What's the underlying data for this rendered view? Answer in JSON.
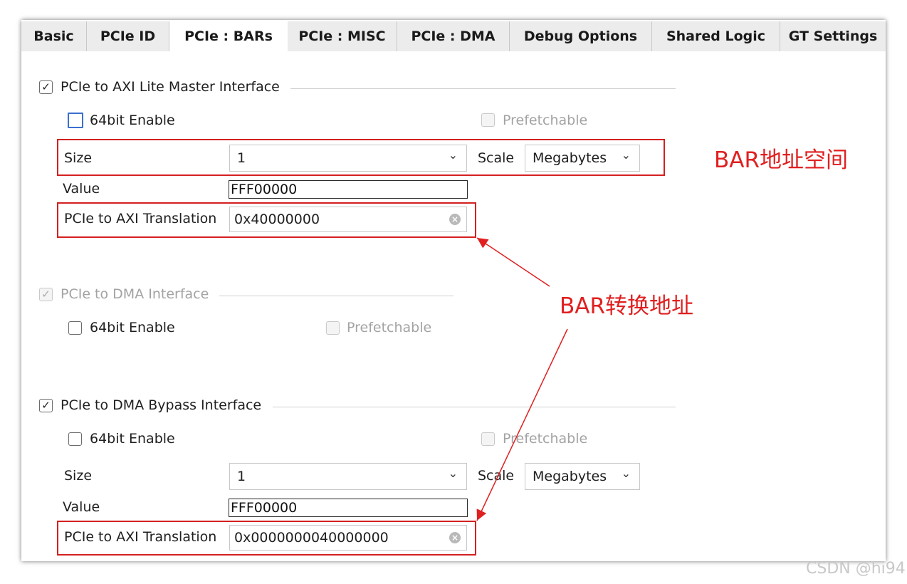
{
  "tabs": [
    {
      "label": "Basic"
    },
    {
      "label": "PCIe ID"
    },
    {
      "label": "PCIe : BARs"
    },
    {
      "label": "PCIe : MISC"
    },
    {
      "label": "PCIe : DMA"
    },
    {
      "label": "Debug Options"
    },
    {
      "label": "Shared Logic"
    },
    {
      "label": "GT Settings"
    }
  ],
  "active_tab": "PCIe : BARs",
  "sections": {
    "axi_lite": {
      "label": "PCIe to AXI Lite Master Interface",
      "checked": true,
      "bit64_label": "64bit Enable",
      "prefetch_label": "Prefetchable",
      "size_label": "Size",
      "size_value": "1",
      "scale_label": "Scale",
      "scale_value": "Megabytes",
      "value_label": "Value",
      "value": "FFF00000",
      "translation_label": "PCIe to AXI Translation",
      "translation_value": "0x40000000"
    },
    "dma": {
      "label": "PCIe to DMA Interface",
      "checked": true,
      "disabled": true,
      "bit64_label": "64bit Enable",
      "prefetch_label": "Prefetchable"
    },
    "bypass": {
      "label": "PCIe to DMA Bypass Interface",
      "checked": true,
      "bit64_label": "64bit Enable",
      "prefetch_label": "Prefetchable",
      "size_label": "Size",
      "size_value": "1",
      "scale_label": "Scale",
      "scale_value": "Megabytes",
      "value_label": "Value",
      "value": "FFF00000",
      "translation_label": "PCIe to AXI Translation",
      "translation_value": "0x0000000040000000"
    }
  },
  "annotations": {
    "bar_space": "BAR地址空间",
    "bar_translation": "BAR转换地址"
  },
  "watermark": "CSDN @hi94",
  "colors": {
    "annotation_red": "#e02020",
    "tabbar_bg": "#e9e9e9",
    "checkbox_focus_blue": "#3a6fd0"
  },
  "icons": {
    "check": "✓",
    "chevron": "⌄",
    "clear": "×"
  }
}
